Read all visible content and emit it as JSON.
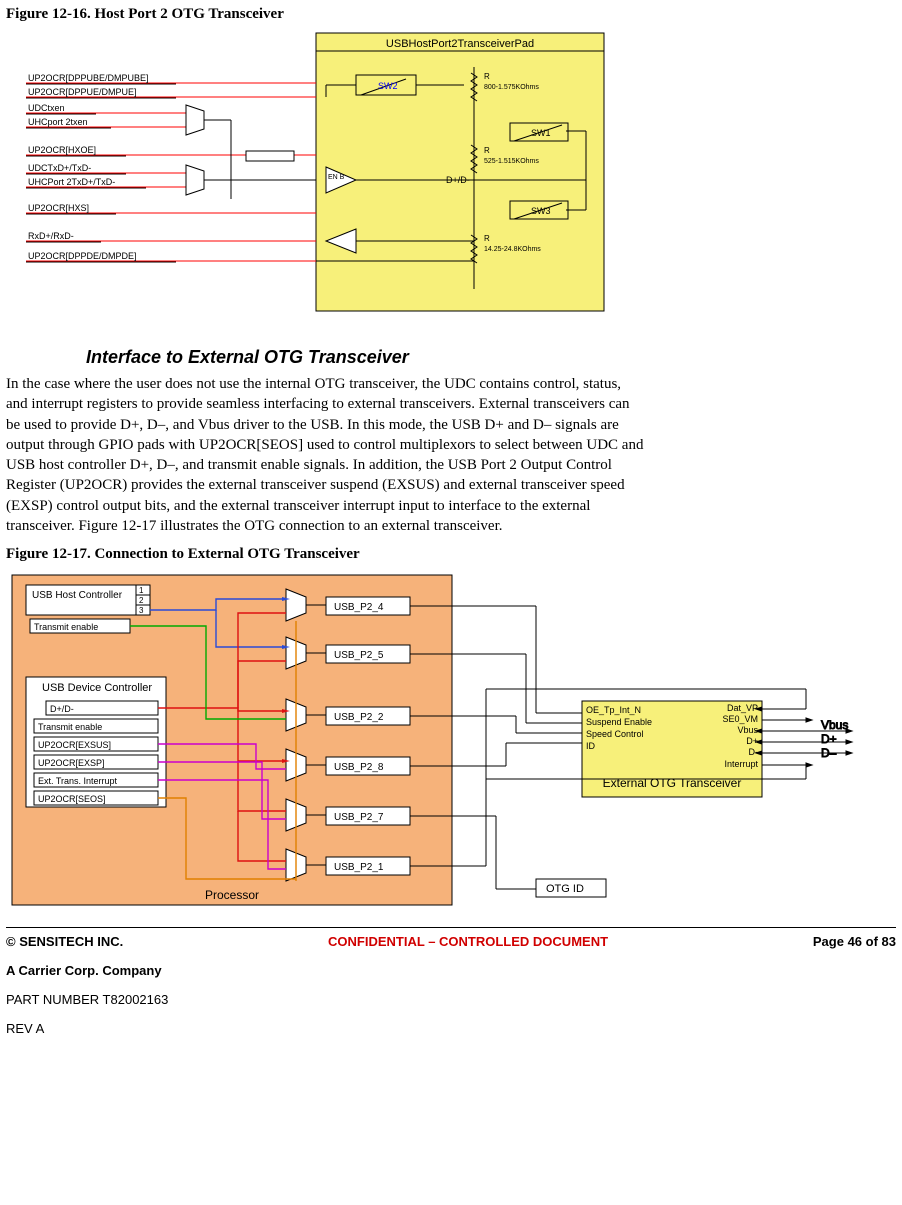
{
  "figure1": {
    "title": "Figure 12-16. Host Port 2 OTG Transceiver",
    "box_header": "USBHostPort2TransceiverPad",
    "signals": [
      "UP2OCR[DPPUBE/DMPUBE]",
      "UP2OCR[DPPUE/DMPUE]",
      "UDCtxen",
      "UHCport 2txen",
      "UP2OCR[HXOE]",
      "UDCTxD+/TxD-",
      "UHCPort 2TxD+/TxD-",
      "UP2OCR[HXS]",
      "RxD+/RxD-",
      "UP2OCR[DPPDE/DMPDE]"
    ],
    "sw_labels": [
      "SW2",
      "SW1",
      "SW3"
    ],
    "res_labels": [
      "R",
      "800-1.575KOhms",
      "R",
      "525-1.515KOhms",
      "D+/D-",
      "R",
      "14.25-24.8KOhms"
    ],
    "enb": "EN B"
  },
  "section": {
    "title": "Interface to External OTG Transceiver",
    "body": "In the case where the user does not use the internal OTG transceiver, the UDC contains control, status, and interrupt registers to provide seamless interfacing to external transceivers. External transceivers can be used to provide D+, D–, and Vbus driver to the USB. In this mode, the USB D+ and D– signals are output through GPIO pads with UP2OCR[SEOS] used to control multiplexors to select between UDC and USB host controller D+, D–, and transmit enable signals. In addition, the USB Port 2 Output Control Register (UP2OCR) provides the external transceiver suspend (EXSUS) and external transceiver speed (EXSP) control output bits, and the external transceiver interrupt input to interface to the external transceiver. Figure 12-17 illustrates the OTG connection to an external transceiver."
  },
  "figure2": {
    "title": "Figure 12-17. Connection to External OTG Transceiver",
    "processor_label": "Processor",
    "host_box": "USB Host Controller",
    "host_sub": "Transmit enable",
    "host_nums": [
      "1",
      "2",
      "3"
    ],
    "device_box": "USB Device Controller",
    "device_rows": [
      "D+/D-",
      "Transmit    enable",
      "UP2OCR[EXSUS]",
      "UP2OCR[EXSP]",
      "Ext. Trans. Interrupt",
      "UP2OCR[SEOS]"
    ],
    "usb_labels": [
      "USB_P2_4",
      "USB_P2_5",
      "USB_P2_2",
      "USB_P2_8",
      "USB_P2_7",
      "USB_P2_1"
    ],
    "ext_box_title": "External OTG Transceiver",
    "ext_left": [
      "OE_Tp_Int_N",
      "Suspend Enable",
      "Speed Control",
      "ID"
    ],
    "ext_right": [
      "Dat_VP",
      "SE0_VM",
      "Vbus",
      "D+",
      "D-",
      "Interrupt"
    ],
    "otg_id": "OTG ID",
    "bus_labels": [
      "Vbus",
      "D+",
      "D–"
    ]
  },
  "footer": {
    "left": "© SENSITECH INC.",
    "mid": "CONFIDENTIAL – CONTROLLED DOCUMENT",
    "right_pre": "Page ",
    "page": "46",
    "of": " of ",
    "total": "83",
    "sub": "A Carrier Corp. Company",
    "part": "PART NUMBER T82002163",
    "rev": "REV A"
  }
}
